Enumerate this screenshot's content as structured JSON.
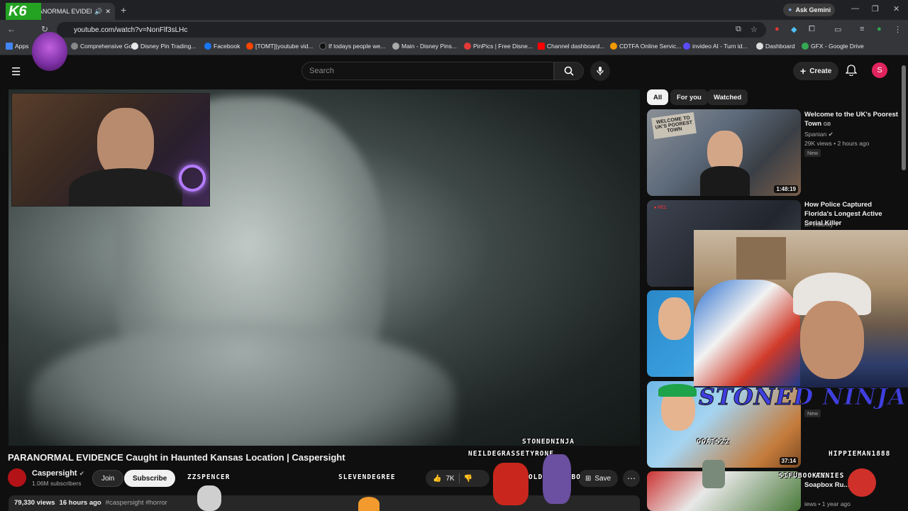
{
  "browser": {
    "tab_title": "PARANORMAL EVIDENCE C",
    "address": "youtube.com/watch?v=NonFlf3sLHc",
    "ask_gemini": "Ask Gemini",
    "bookmarks": [
      "Apps",
      "Comprehensive Gol...",
      "Disney Pin Trading...",
      "Facebook",
      "[TOMT]|youtube vid...",
      "If todays people we...",
      "Main - Disney Pins...",
      "PinPics | Free Disne...",
      "Channel dashboard...",
      "CDTFA Online Servic...",
      "invideo AI - Turn id...",
      "Dashboard",
      "GFX - Google Drive"
    ],
    "bookmark_colors": [
      "#4285f4",
      "#888",
      "#e8e8e8",
      "#1877f2",
      "#ff4500",
      "#111",
      "#aaa",
      "#e53935",
      "#ff0000",
      "#f29900",
      "#5a4bff",
      "#ddd",
      "#34a853"
    ]
  },
  "youtube": {
    "search_placeholder": "Search",
    "create_label": "Create",
    "avatar_letter": "S"
  },
  "video": {
    "title": "PARANORMAL EVIDENCE Caught in Haunted Kansas Location | Caspersight",
    "channel": "Caspersight",
    "subscribers": "1.06M subscribers",
    "join_label": "Join",
    "subscribe_label": "Subscribe",
    "likes": "7K",
    "save_label": "Save",
    "views": "79,330 views",
    "age": "16 hours ago",
    "tags": "#caspersight #horror"
  },
  "chips": [
    "All",
    "For you",
    "Watched"
  ],
  "recommendations": [
    {
      "title": "Welcome to the UK's Poorest Town",
      "flag": "GB",
      "channel": "Spanian",
      "meta": "29K views • 2 hours ago",
      "badge": "New",
      "duration": "1:48:19"
    },
    {
      "title": "How Police Captured Florida's Longest Active Serial Killer",
      "channel": "Dr Insanity"
    },
    {
      "badge": "New",
      "duration": "37:14"
    },
    {
      "title": "Soapbox Ru...",
      "meta": "iews • 1 year ago"
    }
  ],
  "overlay": {
    "stream_logo": "K6",
    "streamer_name": "STONED NINJA",
    "chat_names": [
      "STONEDNINJA",
      "NEILDEGRASSETYRONE",
      "ZZSPENCER",
      "SLEVENDEGREE",
      "OLDMANADOBO",
      "GGATS22",
      "HIPPIEMAN1888",
      "SIFUBOOKIE",
      "ANNIES"
    ]
  }
}
